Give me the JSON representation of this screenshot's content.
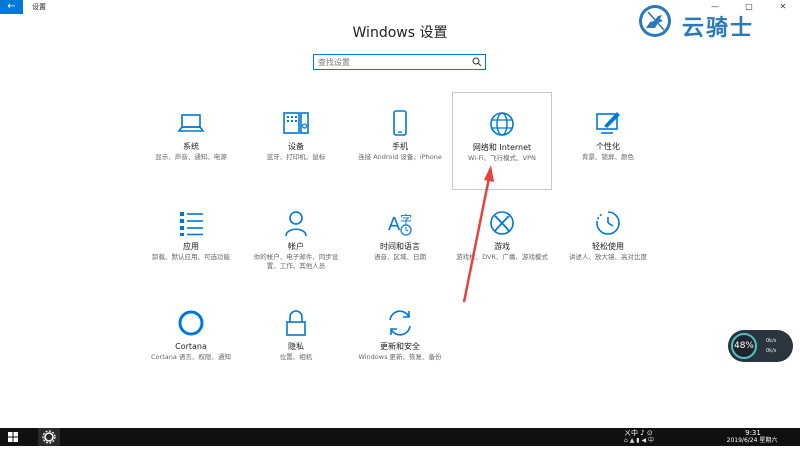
{
  "window": {
    "back_icon": "arrow-left-icon",
    "title": "设置",
    "controls": [
      "—",
      "□",
      "✕"
    ]
  },
  "page": {
    "title": "Windows 设置",
    "search_placeholder": "查找设置"
  },
  "tiles": [
    {
      "label": "系统",
      "desc": "显示、声音、通知、电源",
      "icon": "laptop-icon"
    },
    {
      "label": "设备",
      "desc": "蓝牙、打印机、鼠标",
      "icon": "keyboard-speaker-icon"
    },
    {
      "label": "手机",
      "desc": "连接 Android 设备、iPhone",
      "icon": "phone-icon"
    },
    {
      "label": "网络和 Internet",
      "desc": "Wi-Fi、飞行模式、VPN",
      "icon": "globe-icon"
    },
    {
      "label": "个性化",
      "desc": "背景、锁屏、颜色",
      "icon": "paint-icon"
    },
    {
      "label": "应用",
      "desc": "卸载、默认应用、可选功能",
      "icon": "apps-list-icon"
    },
    {
      "label": "帐户",
      "desc": "你的帐户、电子邮件、同步设置、工作、其他人员",
      "icon": "person-icon"
    },
    {
      "label": "时间和语言",
      "desc": "语音、区域、日期",
      "icon": "time-language-icon"
    },
    {
      "label": "游戏",
      "desc": "游戏栏、DVR、广播、游戏模式",
      "icon": "xbox-icon"
    },
    {
      "label": "轻松使用",
      "desc": "讲述人、放大镜、高对比度",
      "icon": "ease-of-access-icon"
    },
    {
      "label": "Cortana",
      "desc": "Cortana 语言、权限、通知",
      "icon": "cortana-icon"
    },
    {
      "label": "隐私",
      "desc": "位置、相机",
      "icon": "lock-icon"
    },
    {
      "label": "更新和安全",
      "desc": "Windows 更新、恢复、备份",
      "icon": "refresh-icon"
    }
  ],
  "brand": {
    "text": "云骑士",
    "icon": "knight-logo-icon"
  },
  "widget": {
    "percent": "48%",
    "up": "0k/s",
    "down": "0k/s"
  },
  "taskbar": {
    "ime": "ㄨ中 ♪ ⊙",
    "tray": "⌂ ▲ ▮ ◀ 中",
    "time": "9:31",
    "date": "2019/6/24 星期六"
  },
  "colors": {
    "accent": "#0078d7",
    "arrow": "#e8423f",
    "taskbar": "#101010"
  }
}
